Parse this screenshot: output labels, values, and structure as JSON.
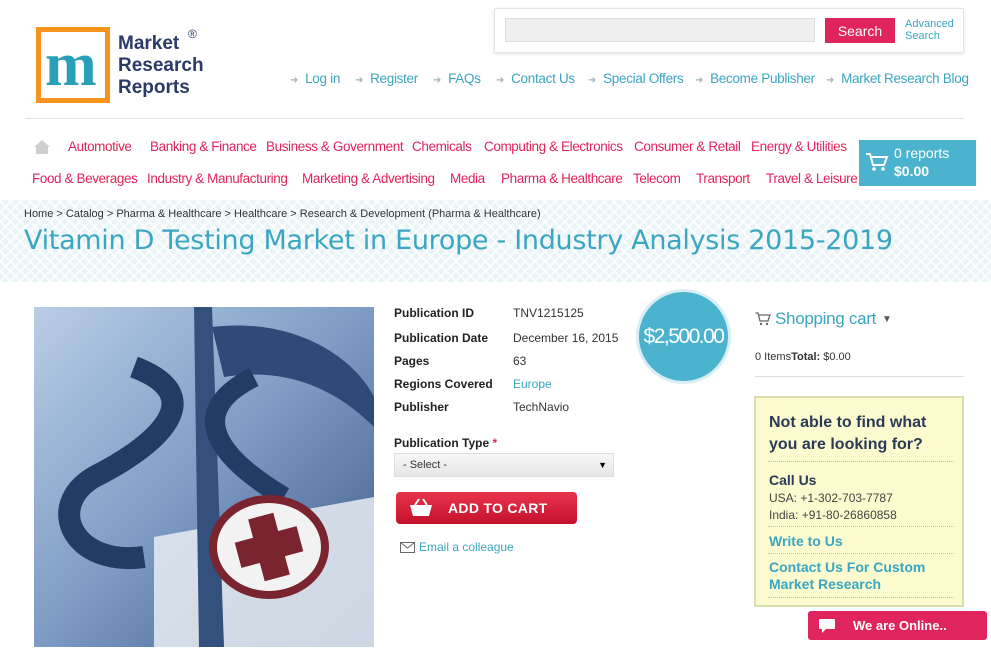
{
  "logo": {
    "line1": "Market",
    "line2": "Research",
    "line3": "Reports",
    "reg": "®"
  },
  "search": {
    "button": "Search",
    "advanced_line1": "Advanced",
    "advanced_line2": "Search",
    "placeholder": ""
  },
  "top_links": [
    "Log in",
    "Register",
    "FAQs",
    "Contact Us",
    "Special Offers",
    "Become Publisher",
    "Market Research Blog"
  ],
  "nav_row1": [
    "Automotive",
    "Banking & Finance",
    "Business & Government",
    "Chemicals",
    "Computing & Electronics",
    "Consumer & Retail",
    "Energy & Utilities"
  ],
  "nav_row2": [
    "Food & Beverages",
    "Industry & Manufacturing",
    "Marketing & Advertising",
    "Media",
    "Pharma & Healthcare",
    "Telecom",
    "Transport",
    "Travel & Leisure"
  ],
  "cart": {
    "count": "0 reports",
    "total": "$0.00"
  },
  "breadcrumb": "Home > Catalog > Pharma & Healthcare > Healthcare > Research & Development (Pharma & Healthcare)",
  "title": "Vitamin D Testing Market in Europe - Industry Analysis 2015-2019",
  "details": {
    "pub_id_label": "Publication ID",
    "pub_id": "TNV1215125",
    "pub_date_label": "Publication Date",
    "pub_date": "December 16, 2015",
    "pages_label": "Pages",
    "pages": "63",
    "regions_label": "Regions Covered",
    "regions": "Europe",
    "publisher_label": "Publisher",
    "publisher": "TechNavio"
  },
  "price": "$2,500.00",
  "pub_type": {
    "label": "Publication Type",
    "required": "*",
    "selected": "- Select -"
  },
  "add_to_cart": "ADD TO CART",
  "email_colleague": "Email a colleague",
  "shopping_cart": {
    "title": "Shopping cart",
    "items": "0 Items",
    "total_label": "Total:",
    "total": " $0.00"
  },
  "help": {
    "question": "Not able to find what you are looking for?",
    "call_us": "Call Us",
    "usa": "USA: +1-302-703-7787",
    "india": "India: +91-80-26860858",
    "write": "Write to Us",
    "custom": "Contact Us For Custom Market Research"
  },
  "online": "We are Online..",
  "colors": {
    "accent": "#3aa6c1",
    "pink": "#e0245e",
    "logo_orange": "#f7941d"
  }
}
